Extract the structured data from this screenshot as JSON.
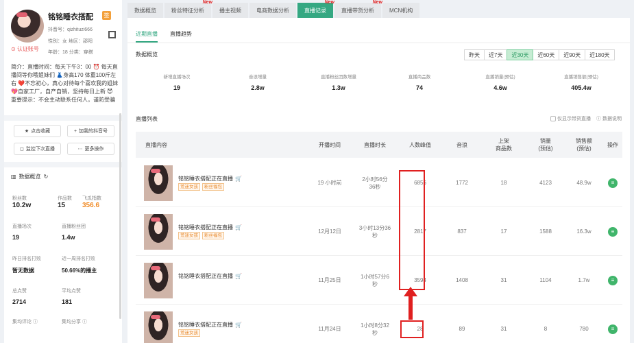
{
  "profile": {
    "nickname": "铭铭睡衣搭配",
    "badge": "签",
    "douyin_id": "抖音号：qizhituzi666",
    "gender_region": "性别：女  地区：邵阳",
    "age_industry": "年龄：18  分类：穿搭",
    "verify": "认证账号",
    "intro_lines": [
      "简介：直播时间：每天下午3：00 ⏰ 每天直",
      "播间等你哦姐妹们 👗身高170 体重100斤左",
      "右 ❤️不忘初心，真心对待每个喜欢我的姐妹",
      "💖自家工厂，自产自销，坚持每日上新 😈",
      "重要提示：不会主动联系任何人，谨防受骗"
    ]
  },
  "actions": {
    "collect": "点击收藏",
    "add_account": "加我的抖音号",
    "monitor": "监控下次直播",
    "more": "更多操作"
  },
  "stats": {
    "title": "数据概览",
    "fans_l": "粉丝数",
    "fans_v": "10.2w",
    "works_l": "作品数",
    "works_v": "15",
    "index_l": "飞瓜指数",
    "index_v": "356.6",
    "live_count_l": "直播场次",
    "live_count_v": "19",
    "live_fans_l": "直播粉丝团",
    "live_fans_v": "1.4w",
    "rank_l": "昨日排名打败",
    "rank_v": "暂无数据",
    "week_rank_l": "近一周排名打败",
    "week_rank_v": "50.66%的播主",
    "total_like_l": "总点赞",
    "total_like_v": "2714",
    "avg_like_l": "平均点赞",
    "avg_like_v": "181",
    "avg_comment_l": "集均评论",
    "avg_share_l": "集均分享"
  },
  "tabs": [
    {
      "label": "数据概览",
      "new": ""
    },
    {
      "label": "粉丝特征分析",
      "new": "New"
    },
    {
      "label": "播主视频",
      "new": ""
    },
    {
      "label": "电商数据分析",
      "new": ""
    },
    {
      "label": "直播记录",
      "new": "New"
    },
    {
      "label": "直播带货分析",
      "new": "New"
    },
    {
      "label": "MCN机构",
      "new": ""
    }
  ],
  "subtabs": [
    "近期直播",
    "直播趋势"
  ],
  "overview": {
    "title": "数据概览",
    "ranges": [
      "昨天",
      "近7天",
      "近30天",
      "近60天",
      "近90天",
      "近180天"
    ],
    "items": [
      {
        "label": "新增直播场次",
        "value": "19"
      },
      {
        "label": "音浪增量",
        "value": "2.8w"
      },
      {
        "label": "直播粉丝团数增量",
        "value": "1.3w"
      },
      {
        "label": "直播商品数",
        "value": "74"
      },
      {
        "label": "直播销量(预估)",
        "value": "4.6w"
      },
      {
        "label": "直播销售额(预估)",
        "value": "405.4w"
      }
    ]
  },
  "live_list": {
    "title": "直播列表",
    "only_goods": "仅显示带货直播",
    "explain": "数据说明",
    "headers": [
      "直播内容",
      "开播时间",
      "直播时长",
      "人数峰值",
      "音浪",
      "上架\n商品数",
      "销量\n(预估)",
      "销售额\n(预估)",
      "操作"
    ],
    "rows": [
      {
        "title": "铭铭睡衣搭配正在直播",
        "tags": [
          "荒迷女孩",
          "粉丝福包"
        ],
        "start": "19 小时前",
        "duration": "2小时56分\n36秒",
        "peak": "6856",
        "yinlang": "1772",
        "goods": "18",
        "sales": "4123",
        "revenue": "48.9w"
      },
      {
        "title": "铭铭睡衣搭配正在直播",
        "tags": [
          "荒迷女孩",
          "粉丝福包"
        ],
        "start": "12月12日",
        "duration": "3小时13分36\n秒",
        "peak": "2817",
        "yinlang": "837",
        "goods": "17",
        "sales": "1588",
        "revenue": "16.3w"
      },
      {
        "title": "铭铭睡衣搭配正在直播",
        "tags": [],
        "start": "11月25日",
        "duration": "1小时57分6\n秒",
        "peak": "3594",
        "yinlang": "1408",
        "goods": "31",
        "sales": "1104",
        "revenue": "1.7w"
      },
      {
        "title": "铭铭睡衣搭配正在直播",
        "tags": [
          "荒迷女孩"
        ],
        "start": "11月24日",
        "duration": "1小时8分32\n秒",
        "peak": "28",
        "yinlang": "89",
        "goods": "31",
        "sales": "8",
        "revenue": "780"
      }
    ]
  }
}
